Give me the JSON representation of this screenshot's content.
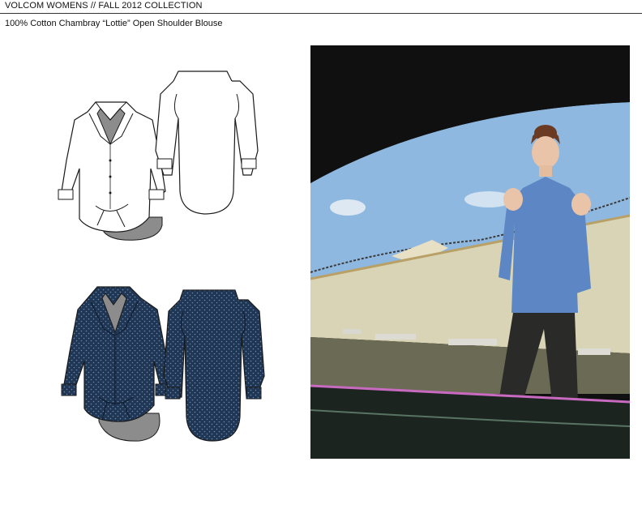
{
  "header": {
    "title": "VOLCOM WOMENS  // FALL 2012 COLLECTION"
  },
  "product": {
    "name": "100% Cotton Chambray “Lottie” Open Shoulder Blouse"
  },
  "colors": {
    "outline": "#1a1a1a",
    "white_garment": "#ffffff",
    "lining_gray": "#8c8c8c",
    "denim_navy": "#1f3655",
    "denim_dot": "#6f88a8",
    "sky": "#8fb8e0",
    "wall": "#d9d4b5",
    "shirt_blue": "#5d87c4",
    "pants": "#2a2a28",
    "car_dark": "#1c2420"
  },
  "illustrations": [
    {
      "view": "front",
      "variant": "white",
      "icon": "blouse-front-flat-sketch"
    },
    {
      "view": "back",
      "variant": "white",
      "icon": "blouse-back-flat-sketch"
    },
    {
      "view": "front",
      "variant": "denim",
      "icon": "blouse-front-flat-sketch"
    },
    {
      "view": "back",
      "variant": "denim",
      "icon": "blouse-back-flat-sketch"
    }
  ]
}
